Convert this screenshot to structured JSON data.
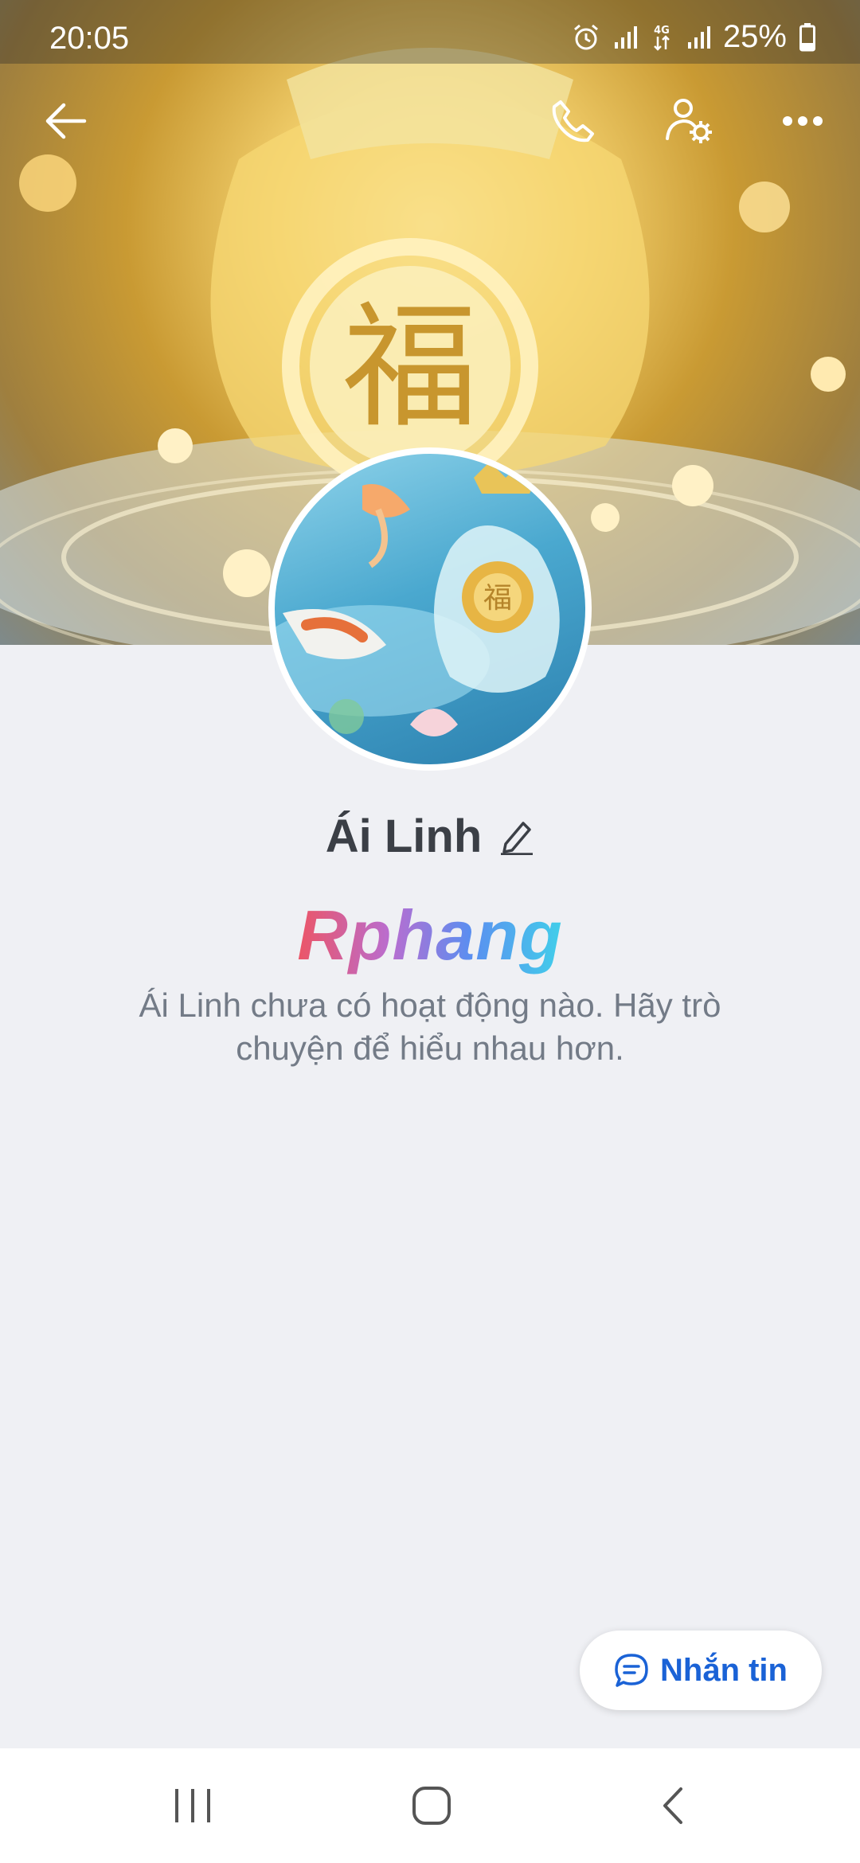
{
  "status_bar": {
    "time": "20:05",
    "network": "4G",
    "battery": "25%"
  },
  "icons": {
    "back": "arrow-left-icon",
    "call": "phone-icon",
    "profile_settings": "user-gear-icon",
    "more": "more-horizontal-icon",
    "edit": "pencil-icon",
    "chat": "chat-bubble-icon"
  },
  "profile": {
    "name": "Ái Linh",
    "logo_text": "Rphang",
    "empty_message": "Ái Linh chưa có hoạt động nào. Hãy trò chuyện để hiểu nhau hơn."
  },
  "actions": {
    "message_label": "Nhắn tin"
  },
  "colors": {
    "accent": "#1a62d6",
    "background": "#eff0f4",
    "name_text": "#3b3f46"
  }
}
